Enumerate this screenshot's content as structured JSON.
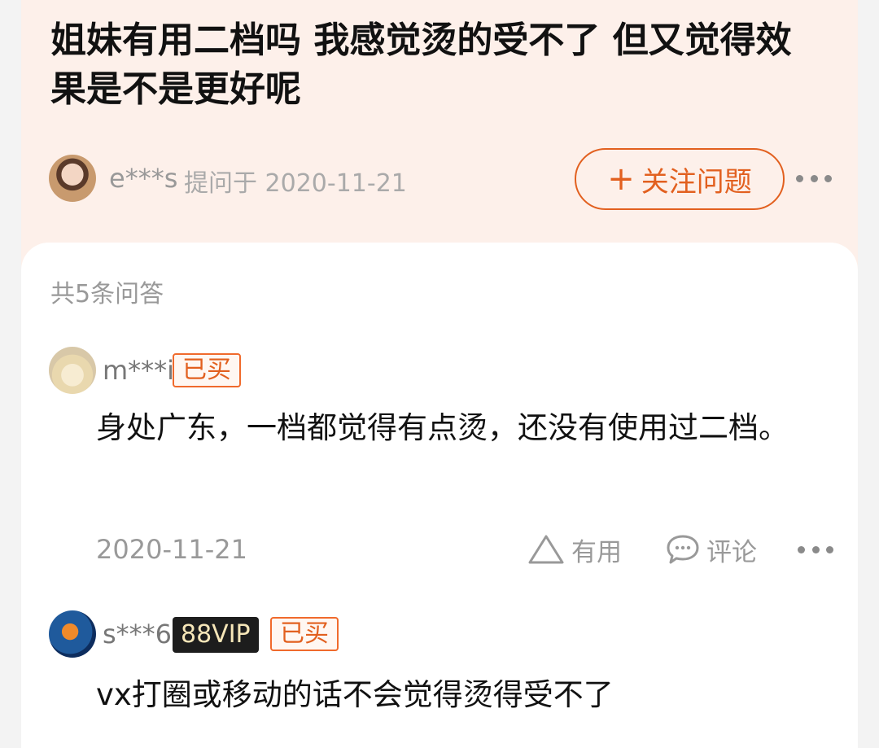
{
  "question": {
    "title": "姐妹有用二档吗 我感觉烫的受不了 但又觉得效果是不是更好呢",
    "asker_name": "e***s",
    "asked_time": "提问于 2020-11-21",
    "follow_button": "关注问题",
    "follow_icon": "plus-icon"
  },
  "answers_summary": {
    "count_label": "共5条问答"
  },
  "answers": [
    {
      "user": "m***i",
      "bought_badge": "已买",
      "text": "身处广东，一档都觉得有点烫，还没有使用过二档。",
      "date": "2020-11-21",
      "useful_label": "有用",
      "comment_label": "评论"
    },
    {
      "user": "s***6",
      "vip_badge": "88VIP",
      "bought_badge": "已买",
      "text": "vx打圈或移动的话不会觉得烫得受不了"
    }
  ],
  "colors": {
    "accent": "#e2601f",
    "question_bg": "#fdf0ea",
    "page_bg": "#f3f3f3"
  }
}
